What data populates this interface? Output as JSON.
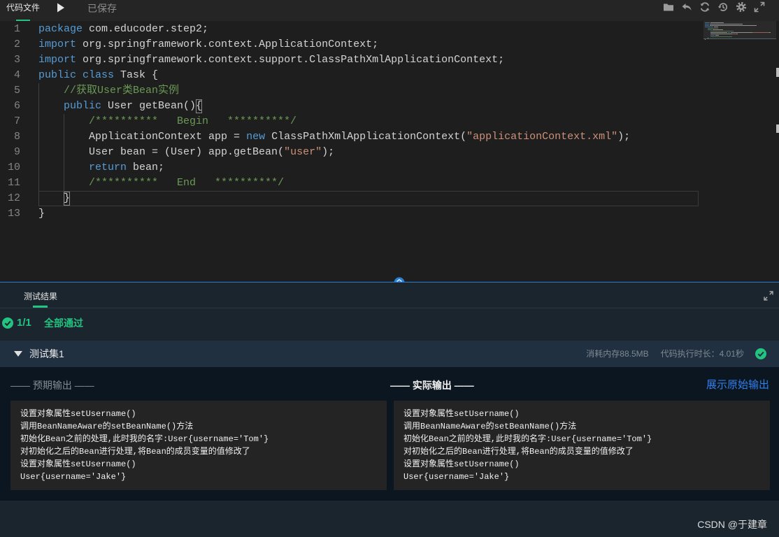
{
  "topbar": {
    "tab_label": "代码文件",
    "save_status": "已保存",
    "icons": [
      "play-icon",
      "folder-icon",
      "undo-icon",
      "refresh-icon",
      "history-icon",
      "gear-icon",
      "fullscreen-icon"
    ]
  },
  "editor": {
    "active_line": 12,
    "lines": [
      {
        "n": "1",
        "tokens": [
          {
            "t": "package",
            "c": "#569cd6"
          },
          {
            "t": " com.educoder.step2;"
          }
        ]
      },
      {
        "n": "2",
        "tokens": [
          {
            "t": "import",
            "c": "#569cd6"
          },
          {
            "t": " org.springframework.context.ApplicationContext;"
          }
        ]
      },
      {
        "n": "3",
        "tokens": [
          {
            "t": "import",
            "c": "#569cd6"
          },
          {
            "t": " org.springframework.context.support.ClassPathXmlApplicationContext;"
          }
        ]
      },
      {
        "n": "4",
        "tokens": [
          {
            "t": "public class",
            "c": "#569cd6"
          },
          {
            "t": " Task {"
          }
        ]
      },
      {
        "n": "5",
        "tokens": [
          {
            "t": "    //获取User类Bean实例",
            "c": "#6a9955"
          }
        ]
      },
      {
        "n": "6",
        "tokens": [
          {
            "t": "    public",
            "c": "#569cd6"
          },
          {
            "t": " User getBean()"
          },
          {
            "t": "{",
            "match": true
          }
        ]
      },
      {
        "n": "7",
        "tokens": [
          {
            "t": "        /**********   Begin   **********/",
            "c": "#6a9955"
          }
        ]
      },
      {
        "n": "8",
        "tokens": [
          {
            "t": "        ApplicationContext app = "
          },
          {
            "t": "new",
            "c": "#569cd6"
          },
          {
            "t": " ClassPathXmlApplicationContext("
          },
          {
            "t": "\"applicationContext.xml\"",
            "c": "#ce9178"
          },
          {
            "t": ");"
          }
        ]
      },
      {
        "n": "9",
        "tokens": [
          {
            "t": "        User bean = (User) app.getBean("
          },
          {
            "t": "\"user\"",
            "c": "#ce9178"
          },
          {
            "t": ");"
          }
        ]
      },
      {
        "n": "10",
        "tokens": [
          {
            "t": "        return",
            "c": "#569cd6"
          },
          {
            "t": " bean;"
          }
        ]
      },
      {
        "n": "11",
        "tokens": [
          {
            "t": "        /**********   End   **********/",
            "c": "#6a9955"
          }
        ]
      },
      {
        "n": "12",
        "tokens": [
          {
            "t": "    "
          },
          {
            "t": "}",
            "match": true
          }
        ]
      },
      {
        "n": "13",
        "tokens": [
          {
            "t": "}"
          }
        ]
      }
    ]
  },
  "results": {
    "tab_label": "测试结果",
    "summary": {
      "count": "1/1",
      "status": "全部通过"
    },
    "test_set": {
      "name": "测试集1",
      "memory": "消耗内存88.5MB",
      "duration": "代码执行时长：4.01秒",
      "expected_title": "—— 预期输出 ——",
      "actual_title": "—— 实际输出 ——",
      "show_raw_label": "展示原始输出",
      "expected_output": [
        "设置对象属性setUsername()",
        "调用BeanNameAware的setBeanName()方法",
        "初始化Bean之前的处理,此时我的名字:User{username='Tom'}",
        "对初始化之后的Bean进行处理,将Bean的成员变量的值修改了",
        "设置对象属性setUsername()",
        "User{username='Jake'}"
      ],
      "actual_output": [
        "设置对象属性setUsername()",
        "调用BeanNameAware的setBeanName()方法",
        "初始化Bean之前的处理,此时我的名字:User{username='Tom'}",
        "对初始化之后的Bean进行处理,将Bean的成员变量的值修改了",
        "设置对象属性setUsername()",
        "User{username='Jake'}"
      ]
    }
  },
  "watermark": "CSDN @于建章",
  "colors": {
    "editor_bg": "#1e1e1e",
    "text": "#d4d4d4",
    "keyword": "#569cd6",
    "comment": "#6a9955",
    "string": "#ce9178",
    "pass_green": "#23c380",
    "link_blue": "#2f80ed",
    "divider_blue": "#2a7fd4"
  }
}
